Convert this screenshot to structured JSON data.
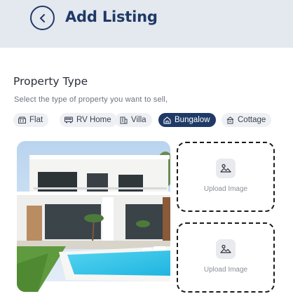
{
  "header": {
    "title": "Add Listing",
    "back_icon": "chevron-left-icon"
  },
  "property_type": {
    "title": "Property Type",
    "subtitle": "Select the type of property you want to sell,",
    "selected": "Bungalow",
    "options": [
      {
        "label": "Flat",
        "icon": "building-icon"
      },
      {
        "label": "RV Home",
        "icon": "rv-icon"
      },
      {
        "label": "Villa",
        "icon": "villa-icon"
      },
      {
        "label": "Bungalow",
        "icon": "home-icon"
      },
      {
        "label": "Cottage",
        "icon": "cottage-icon"
      }
    ]
  },
  "media": {
    "photo_icon": "property-photo",
    "upload_slots": [
      {
        "label": "Upload Image",
        "icon": "image-icon"
      },
      {
        "label": "Upload Image",
        "icon": "image-icon"
      }
    ]
  },
  "colors": {
    "accent": "#1f3a66",
    "header_bg": "#e4e8ef",
    "chip_bg": "#eef0f4"
  }
}
